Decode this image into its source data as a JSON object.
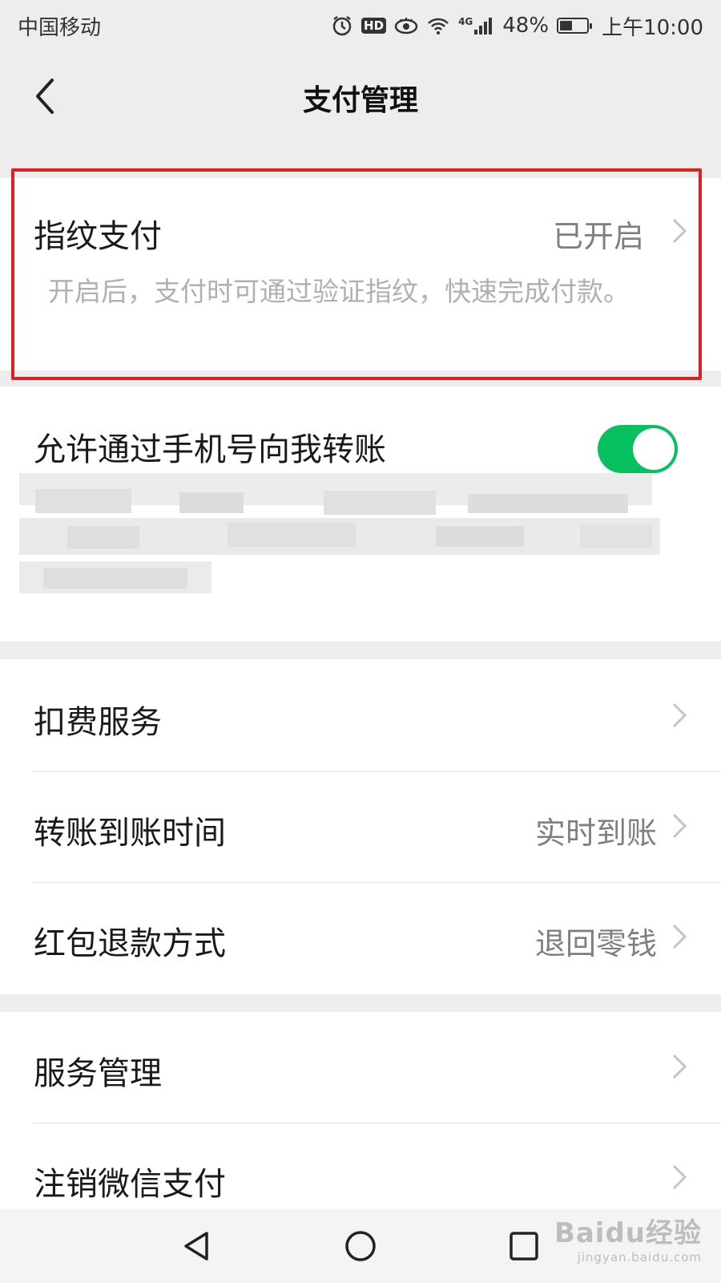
{
  "status_bar": {
    "carrier": "中国移动",
    "network": "4G",
    "battery": "48%",
    "battery_level": 0.48,
    "time": "上午10:00",
    "hd_label": "HD",
    "icons": [
      "alarm-icon",
      "hd-icon",
      "eye-icon",
      "wifi-icon",
      "signal-icon",
      "battery-icon"
    ]
  },
  "header": {
    "title": "支付管理",
    "back_icon": "back-arrow-icon"
  },
  "fingerprint": {
    "title": "指纹支付",
    "value": "已开启",
    "description": "开启后，支付时可通过验证指纹，快速完成付款。"
  },
  "phone_transfer": {
    "title": "允许通过手机号向我转账",
    "toggle_on": true,
    "toggle_color": "#07c160"
  },
  "menu_group_1": [
    {
      "title": "扣费服务",
      "value": ""
    },
    {
      "title": "转账到账时间",
      "value": "实时到账"
    },
    {
      "title": "红包退款方式",
      "value": "退回零钱"
    }
  ],
  "menu_group_2": [
    {
      "title": "服务管理",
      "value": ""
    },
    {
      "title": "注销微信支付",
      "value": ""
    }
  ],
  "system_nav": [
    "back-triangle-icon",
    "home-circle-icon",
    "recent-square-icon"
  ],
  "watermark": {
    "main": "Baidu经验",
    "sub": "jingyan.baidu.com"
  },
  "colors": {
    "highlight": "#e02020",
    "background": "#ededed",
    "toggle": "#07c160"
  }
}
